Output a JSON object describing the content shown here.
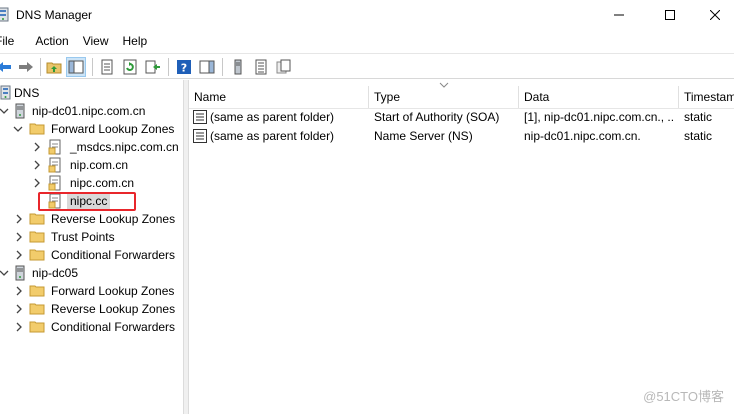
{
  "window": {
    "title": "DNS Manager",
    "controls": {
      "minimize": "minimize",
      "maximize": "maximize",
      "close": "close"
    }
  },
  "menu": {
    "items": [
      "File",
      "Action",
      "View",
      "Help"
    ]
  },
  "tree": {
    "root": "DNS",
    "servers": [
      {
        "name": "nip-dc01.nipc.com.cn",
        "forward": "Forward Lookup Zones",
        "zones": [
          "_msdcs.nipc.com.cn",
          "nip.com.cn",
          "nipc.com.cn",
          "nipc.cc"
        ],
        "reverse": "Reverse Lookup Zones",
        "trust": "Trust Points",
        "conditional": "Conditional Forwarders"
      },
      {
        "name": "nip-dc05",
        "forward": "Forward Lookup Zones",
        "reverse": "Reverse Lookup Zones",
        "conditional": "Conditional Forwarders"
      }
    ],
    "selected": "nipc.cc"
  },
  "list": {
    "columns": [
      "Name",
      "Type",
      "Data",
      "Timestamp"
    ],
    "rows": [
      {
        "name": "(same as parent folder)",
        "type": "Start of Authority (SOA)",
        "data": "[1], nip-dc01.nipc.com.cn., ...",
        "timestamp": "static"
      },
      {
        "name": "(same as parent folder)",
        "type": "Name Server (NS)",
        "data": "nip-dc01.nipc.com.cn.",
        "timestamp": "static"
      }
    ]
  },
  "watermark": "@51CTO博客"
}
